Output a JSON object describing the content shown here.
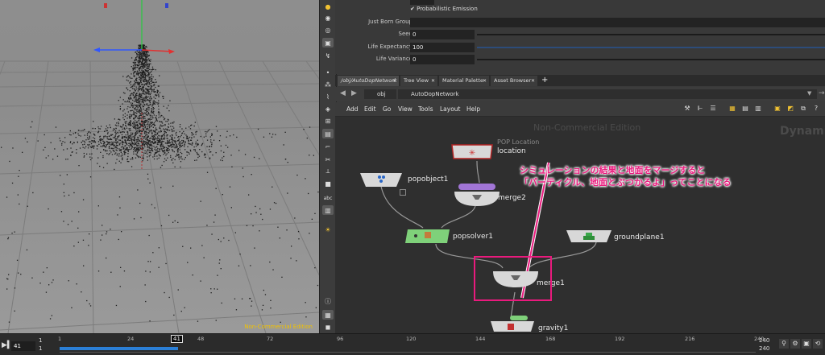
{
  "viewport": {
    "nc_badge": "Non-Commercial Edition"
  },
  "params": {
    "rows": [
      {
        "label": "",
        "value": "",
        "kind": "field"
      },
      {
        "label": "",
        "value": "Probabilistic Emission",
        "kind": "check"
      },
      {
        "label": "Just Born Group",
        "value": "",
        "kind": "field"
      },
      {
        "label": "Seed",
        "value": "0",
        "kind": "slider"
      },
      {
        "label": "Life Expectancy",
        "value": "100",
        "kind": "slider"
      },
      {
        "label": "Life Variance",
        "value": "0",
        "kind": "slider"
      }
    ]
  },
  "tabs": [
    {
      "label": "/obj/AutoDopNetwork",
      "active": true
    },
    {
      "label": "Tree View",
      "active": false
    },
    {
      "label": "Material Palette",
      "active": false
    },
    {
      "label": "Asset Browser",
      "active": false
    }
  ],
  "path": {
    "root": "obj",
    "current": "AutoDopNetwork"
  },
  "menu": [
    "Add",
    "Edit",
    "Go",
    "View",
    "Tools",
    "Layout",
    "Help"
  ],
  "network": {
    "watermark": "Non-Commercial Edition",
    "watermark_right": "Dynami",
    "nodes": {
      "location": {
        "name": "location",
        "type": "POP Location"
      },
      "popobject1": {
        "name": "popobject1"
      },
      "merge2": {
        "name": "merge2"
      },
      "popsolver1": {
        "name": "popsolver1"
      },
      "groundplane1": {
        "name": "groundplane1"
      },
      "merge1": {
        "name": "merge1"
      },
      "gravity1": {
        "name": "gravity1"
      }
    },
    "note_line1": "シミュレーションの結果と地面をマージすると",
    "note_line2": "「パーティクル、地面とぶつかるよ」ってことになる"
  },
  "timeline": {
    "current_frame": "41",
    "start_frame": "1",
    "start_frame2": "1",
    "ticks": [
      "1",
      "24",
      "48",
      "72",
      "96",
      "120",
      "144",
      "168",
      "192",
      "216",
      "240"
    ],
    "playhead_label": "41",
    "end_frame": "240",
    "end_frame2": "240",
    "range_fraction": 0.17
  },
  "colors": {
    "accent": "#e91a7d",
    "solver_node": "#7fd17a",
    "timeline_range": "#2b7fd6",
    "merge_pill": "#a175d6"
  }
}
